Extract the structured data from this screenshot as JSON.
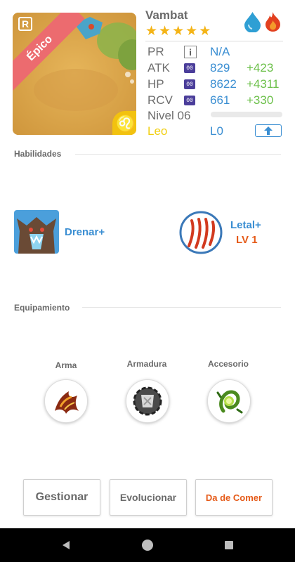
{
  "monster": {
    "name": "Vambat",
    "rarity_label": "Épico",
    "rarity_badge": "R",
    "zodiac_glyph": "♌",
    "stars": [
      "★",
      "★",
      "★",
      "★",
      "★"
    ],
    "elements": [
      "water-drop-icon",
      "fire-icon"
    ]
  },
  "stats": {
    "pr": {
      "label": "PR",
      "value": "N/A",
      "chip": "i"
    },
    "atk": {
      "label": "ATK",
      "chip": "00",
      "value": "829",
      "plus": "+423"
    },
    "hp": {
      "label": "HP",
      "chip": "00",
      "value": "8622",
      "plus": "+4311"
    },
    "rcv": {
      "label": "RCV",
      "chip": "00",
      "value": "661",
      "plus": "+330"
    },
    "level": {
      "label": "Nivel 06",
      "progress": 0
    },
    "sign": "Leo",
    "l_level": "L0"
  },
  "abilities": {
    "title": "Habilidades",
    "passive": {
      "name": "Drenar+"
    },
    "skill": {
      "name": "Letal+",
      "level": "LV 1"
    }
  },
  "equipment": {
    "title": "Equipamiento",
    "slots": [
      {
        "label": "Arma"
      },
      {
        "label": "Armadura"
      },
      {
        "label": "Accesorio"
      }
    ]
  },
  "actions": {
    "manage": "Gestionar",
    "evolve": "Evolucionar",
    "feed": "Da de Comer"
  },
  "colors": {
    "accent_blue": "#3a8ed2",
    "plus_green": "#6cc04a",
    "rarity_red": "#ec6b6f",
    "feed_orange": "#e55a18",
    "sign_yellow": "#f1cf12"
  }
}
